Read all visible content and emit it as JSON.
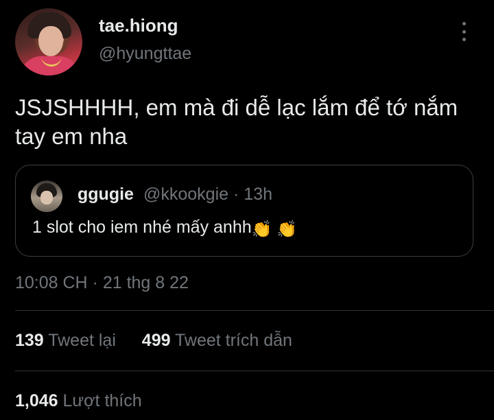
{
  "author": {
    "display_name": "tae.hiong",
    "handle": "@hyungttae"
  },
  "tweet": {
    "text": "JSJSHHHH, em mà đi dễ lạc lắm để tớ nắm tay em nha",
    "timestamp": "10:08 CH · 21 thg 8 22"
  },
  "quoted_tweet": {
    "display_name": "ggugie",
    "meta": "@kkookgie · 13h",
    "text": "1 slot cho iem nhé mấy anhh",
    "emojis": "👏 👏"
  },
  "stats": {
    "retweets_count": "139",
    "retweets_label": "Tweet lại",
    "quotes_count": "499",
    "quotes_label": "Tweet trích dẫn",
    "likes_count": "1,046",
    "likes_label": "Lượt thích"
  },
  "icons": {
    "more": "more-vertical-icon",
    "clap": "clapping-hands-emoji"
  },
  "colors": {
    "background": "#000000",
    "text_primary": "#e7e9ea",
    "text_secondary": "#71767b",
    "border": "#2f3336"
  }
}
